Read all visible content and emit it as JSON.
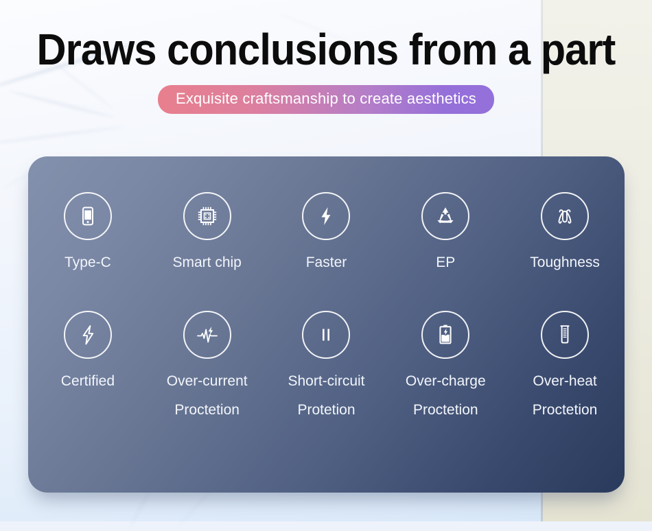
{
  "header": {
    "title": "Draws conclusions from a part",
    "badge": "Exquisite craftsmanship to create aesthetics",
    "badge_gradient_from": "#e87f8d",
    "badge_gradient_to": "#9470db",
    "title_color": "#0c0c0c"
  },
  "card": {
    "gradient_from": "#8491ad",
    "gradient_to": "#2a3a5c",
    "corner_radius_px": 28,
    "rows": [
      {
        "name": "features-row",
        "cells": [
          {
            "icon": "smartphone-icon",
            "label": "Type-C",
            "label2": ""
          },
          {
            "icon": "cpu-chip-icon",
            "label": "Smart chip",
            "label2": ""
          },
          {
            "icon": "lightning-bolt-filled-icon",
            "label": "Faster",
            "label2": ""
          },
          {
            "icon": "recycle-icon",
            "label": "EP",
            "label2": ""
          },
          {
            "icon": "wavy-cable-icon",
            "label": "Toughness",
            "label2": ""
          }
        ]
      },
      {
        "name": "protections-row",
        "cells": [
          {
            "icon": "lightning-bolt-outline-icon",
            "label": "Certified",
            "label2": ""
          },
          {
            "icon": "waveform-bolt-icon",
            "label": "Over-current",
            "label2": "Proctetion"
          },
          {
            "icon": "pause-bars-icon",
            "label": "Short-circuit",
            "label2": "Protetion"
          },
          {
            "icon": "battery-bolt-icon",
            "label": "Over-charge",
            "label2": "Proctetion"
          },
          {
            "icon": "thermometer-icon",
            "label": "Over-heat",
            "label2": "Proctetion"
          }
        ]
      }
    ]
  },
  "background": {
    "left_panel_color": "#eef3fb",
    "right_panel_color": "#e9e7da"
  }
}
